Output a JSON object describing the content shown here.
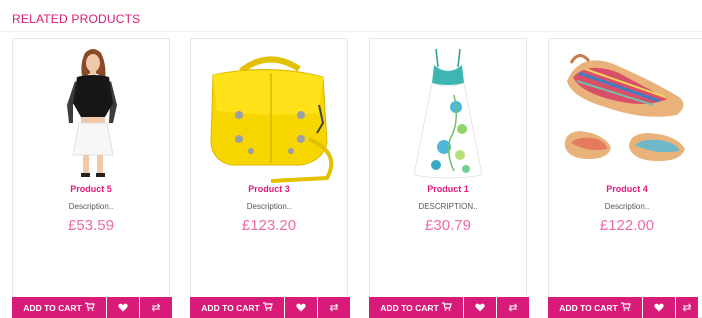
{
  "section": {
    "title": "RELATED PRODUCTS"
  },
  "products": [
    {
      "name": "Product 5",
      "description": "Description..",
      "price": "£53.59",
      "image": "woman-black-top-white-skirt"
    },
    {
      "name": "Product 3",
      "description": "Description..",
      "price": "£123.20",
      "image": "yellow-leather-bag"
    },
    {
      "name": "Product 1",
      "description": "DESCRIPTION..",
      "price": "£30.79",
      "image": "floral-sundress"
    },
    {
      "name": "Product 4",
      "description": "Description..",
      "price": "£122.00",
      "image": "striped-sandals"
    }
  ],
  "actions": {
    "add_to_cart": "ADD TO CART",
    "cart_icon": "cart-icon",
    "wishlist_icon": "heart-icon",
    "compare_icon": "compare-arrows-icon"
  },
  "colors": {
    "accent": "#d81b78",
    "price": "#ef6aa9",
    "name": "#e0197d"
  }
}
